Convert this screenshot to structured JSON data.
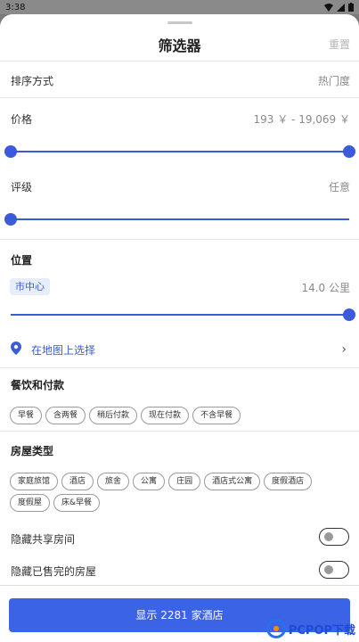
{
  "status": {
    "time": "3:38"
  },
  "sheet": {
    "title": "筛选器",
    "reset": "重置"
  },
  "sort": {
    "label": "排序方式",
    "value": "热门度"
  },
  "price": {
    "label": "价格",
    "value": "193 ￥ - 19,069 ￥",
    "range_fraction": [
      0.0,
      1.0
    ]
  },
  "rating": {
    "label": "评级",
    "value": "任意",
    "level_fraction": 0.0
  },
  "location": {
    "label": "位置",
    "chip": "市中心",
    "distance": "14.0 公里",
    "level_fraction": 1.0,
    "map_link": "在地图上选择"
  },
  "meals": {
    "label": "餐饮和付款",
    "options": [
      "早餐",
      "含两餐",
      "稍后付款",
      "现在付款",
      "不含早餐"
    ]
  },
  "property_types": {
    "label": "房屋类型",
    "options": [
      "家庭旅馆",
      "酒店",
      "旅舍",
      "公寓",
      "庄园",
      "酒店式公寓",
      "度假酒店",
      "度假屋",
      "床&早餐"
    ]
  },
  "toggles": {
    "hide_shared": "隐藏共享房间",
    "hide_soldout": "隐藏已售完的房屋"
  },
  "cta": {
    "label": "显示 2281 家酒店"
  },
  "watermark": {
    "text": "PCPOP下载"
  },
  "colors": {
    "accent": "#3b5bdb",
    "button": "#3b63e6"
  }
}
